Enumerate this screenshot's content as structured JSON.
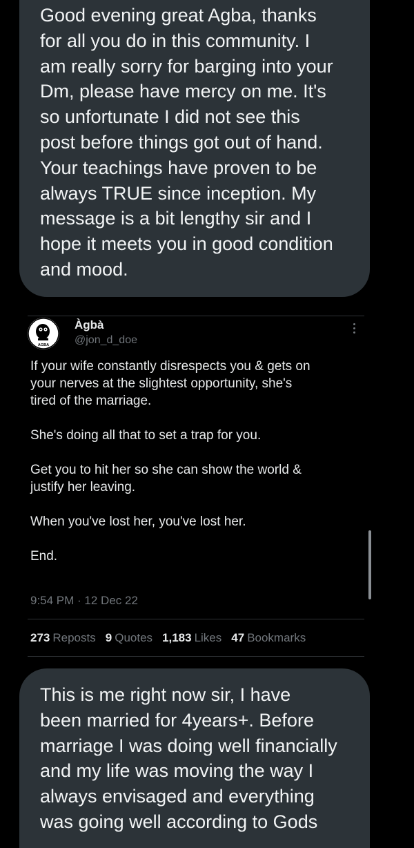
{
  "messages": {
    "top": "Good evening great Agba, thanks\nfor all you do in this community. I\nam really sorry for barging into your\nDm, please have mercy on me. It's\nso unfortunate I did not see this\npost before things got out of hand.\nYour teachings have proven to be\nalways TRUE since inception. My\nmessage is a bit lengthy sir and I\nhope it meets you in good condition\nand mood.",
    "bottom": "This is me right now sir, I have\nbeen married for 4years+. Before\nmarriage I was doing well financially\nand my life was moving the way I\nalways envisaged and everything\nwas going well according to Gods"
  },
  "tweet": {
    "author_name": "Àgbà",
    "handle": "@jon_d_doe",
    "avatar_text": "AGBA",
    "paragraphs": [
      "If your wife constantly disrespects you & gets on\nyour nerves at the slightest opportunity, she's\ntired of the marriage.",
      "She's doing all that to set a trap for you.",
      "Get you to hit her so she can show the world &\njustify her leaving.",
      "When you've lost her, you've lost her.",
      "End."
    ],
    "timestamp": "9:54 PM · 12 Dec 22",
    "stats": {
      "reposts_count": "273",
      "reposts_label": "Reposts",
      "quotes_count": "9",
      "quotes_label": "Quotes",
      "likes_count": "1,183",
      "likes_label": "Likes",
      "bookmarks_count": "47",
      "bookmarks_label": "Bookmarks"
    }
  },
  "icons": {
    "avatar": "agba-logo-icon",
    "more": "more-options-icon"
  },
  "colors": {
    "background": "#000000",
    "bubble": "#2c3338",
    "muted": "#71767b",
    "text": "#e7e9ea"
  }
}
